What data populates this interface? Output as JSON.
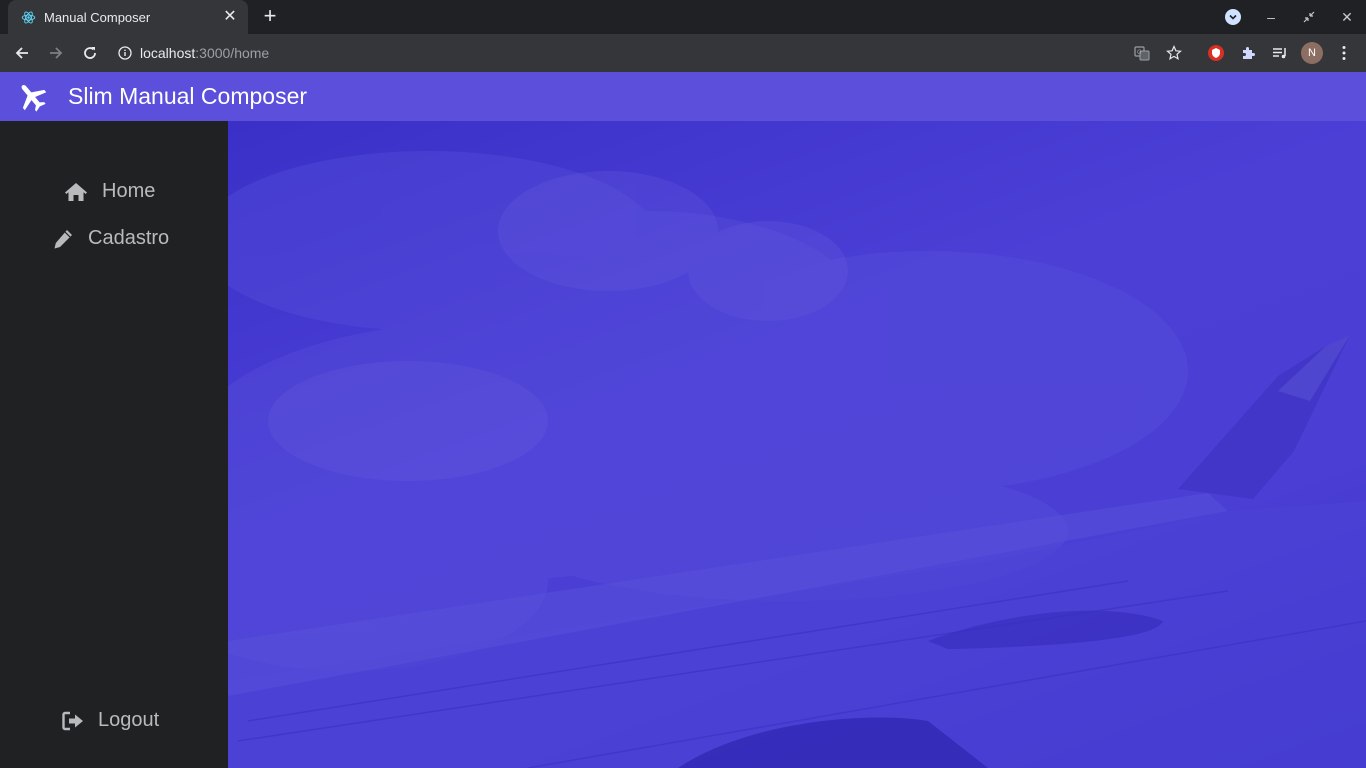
{
  "browser": {
    "tab_title": "Manual Composer",
    "url_host": "localhost",
    "url_path": ":3000/home",
    "profile_initial": "N"
  },
  "app": {
    "title": "Slim Manual Composer",
    "brand_color": "#5b4fdc",
    "sidebar_color": "#1f2123"
  },
  "sidebar": {
    "items": [
      {
        "label": "Home",
        "icon": "home-icon"
      },
      {
        "label": "Cadastro",
        "icon": "pencil-icon"
      }
    ],
    "logout_label": "Logout"
  },
  "main": {
    "background": "airplane-wing-over-clouds image with blue overlay"
  }
}
